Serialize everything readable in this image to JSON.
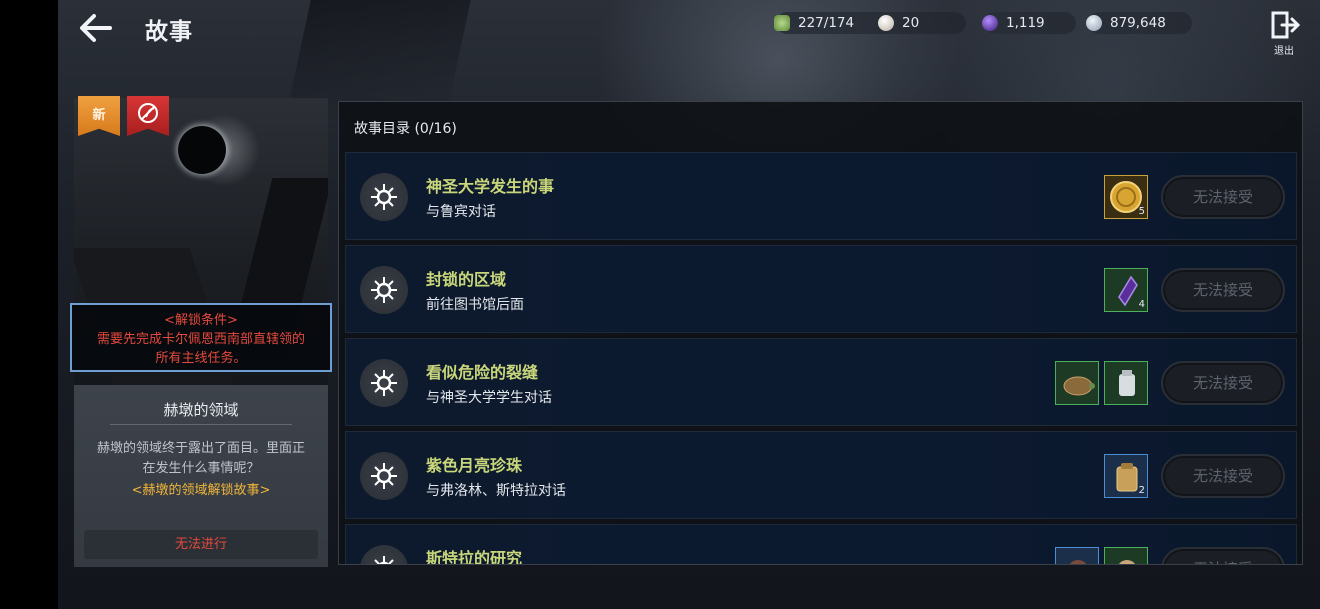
{
  "header": {
    "title": "故事",
    "back_icon": "back-arrow-icon",
    "exit_label": "退出"
  },
  "currencies": [
    {
      "icon": "stamina-icon",
      "value": "227/174",
      "color": "#8fb86a"
    },
    {
      "icon": "pearl-icon",
      "value": "20",
      "color": "#d9d2c6"
    },
    {
      "icon": "dark-crystal-icon",
      "value": "1,119",
      "color": "#6a3fb8"
    },
    {
      "icon": "silver-coin-icon",
      "value": "879,648",
      "color": "#b9c6d6"
    }
  ],
  "story_card": {
    "badge_new": "新",
    "badge_special_icon": "quill-slash-icon",
    "unlock_title": "<解锁条件>",
    "unlock_line1": "需要先完成卡尔佩恩西南部直辖领的",
    "unlock_line2": "所有主线任务。",
    "region_title": "赫墩的领域",
    "desc_line1": "赫墩的领域终于露出了面目。里面正",
    "desc_line2": "在发生什么事情呢？",
    "hint": "<赫墩的领域解锁故事>",
    "action_label": "无法进行"
  },
  "list": {
    "header": "故事目录 (0/16)",
    "button_label": "无法接受",
    "quests": [
      {
        "title": "神圣大学发生的事",
        "subtitle": "与鲁宾对话",
        "rewards": [
          {
            "icon": "gold-coin-icon",
            "count": "5",
            "color": "#d8a532"
          }
        ]
      },
      {
        "title": "封锁的区域",
        "subtitle": "前往图书馆后面",
        "rewards": [
          {
            "icon": "purple-crystal-icon",
            "count": "4",
            "color": "#6b3bb0"
          }
        ]
      },
      {
        "title": "看似危险的裂缝",
        "subtitle": "与神圣大学学生对话",
        "rewards": [
          {
            "icon": "turtle-icon",
            "count": "",
            "color": "#8a6a3a"
          },
          {
            "icon": "milk-jug-icon",
            "count": "",
            "color": "#d8dde0"
          }
        ]
      },
      {
        "title": "紫色月亮珍珠",
        "subtitle": "与弗洛林、斯特拉对话",
        "rewards": [
          {
            "icon": "backpack-icon",
            "count": "2",
            "color": "#c8a05a"
          }
        ]
      },
      {
        "title": "斯特拉的研究",
        "subtitle": "",
        "rewards": [
          {
            "icon": "item-icon",
            "count": "",
            "color": "#7a4a3a"
          },
          {
            "icon": "item-icon",
            "count": "",
            "color": "#c9a77a"
          }
        ]
      }
    ]
  }
}
